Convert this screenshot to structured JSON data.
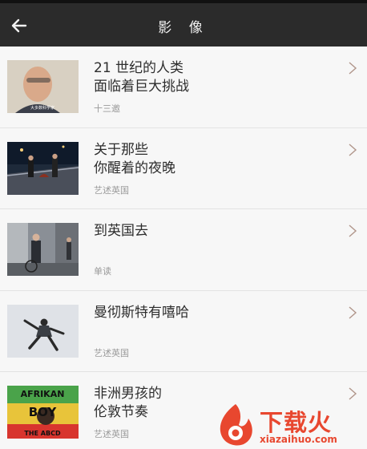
{
  "header": {
    "title": "影 像",
    "back_icon": "arrow-left-icon"
  },
  "items": [
    {
      "title_lines": [
        "21 世纪的人类",
        "面临着巨大挑战"
      ],
      "source": "十三邀",
      "thumb_caption": "大多数科学家"
    },
    {
      "title_lines": [
        "关于那些",
        "你醒着的夜晚"
      ],
      "source": "艺述英国"
    },
    {
      "title_lines": [
        "到英国去"
      ],
      "source": "单读"
    },
    {
      "title_lines": [
        "曼彻斯特有嘻哈"
      ],
      "source": "艺述英国"
    },
    {
      "title_lines": [
        "非洲男孩的",
        "伦敦节奏"
      ],
      "source": "艺述英国",
      "thumb_text_top": "AFRIKAN",
      "thumb_text_mid": "BOY",
      "thumb_text_bottom": "THE ABCD"
    }
  ],
  "watermark": {
    "brand": "下载火",
    "url": "xiazaihuo.com",
    "color": "#e8472f"
  },
  "colors": {
    "topbar": "#2b2b2b",
    "background": "#f7f7f7",
    "title_text": "#2d2d2d",
    "source_text": "#9a9a9a"
  }
}
